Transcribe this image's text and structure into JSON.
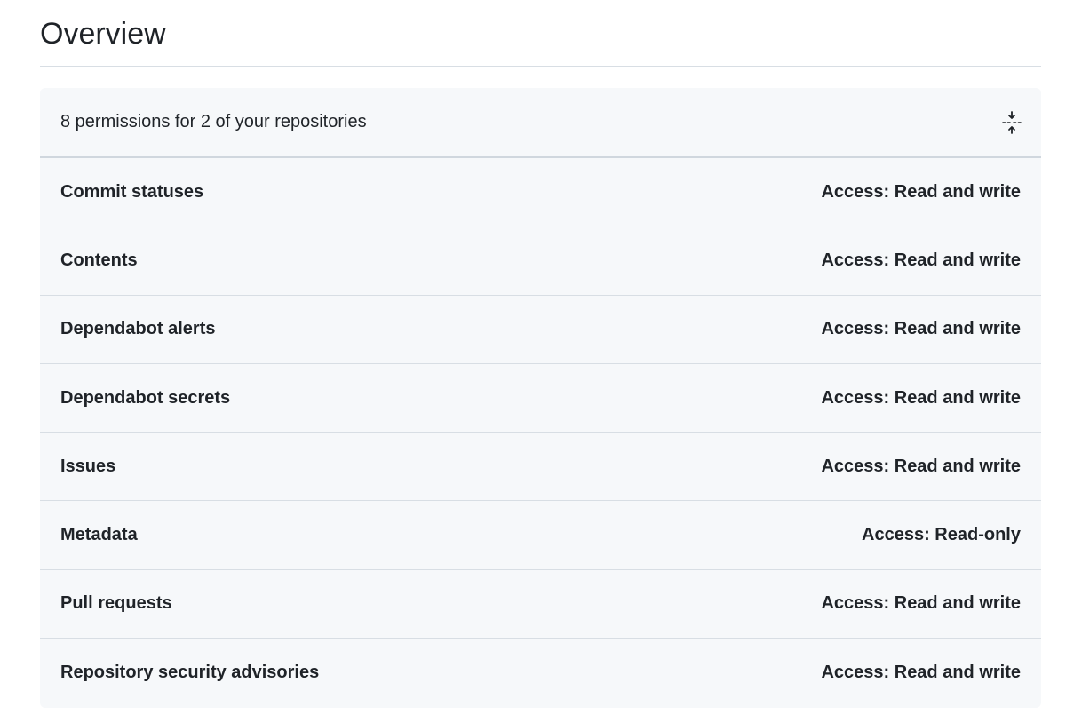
{
  "page": {
    "title": "Overview"
  },
  "panel": {
    "summary": "8 permissions for 2 of your repositories",
    "collapse_icon": "fold-icon"
  },
  "permissions": [
    {
      "name": "Commit statuses",
      "access": "Access: Read and write"
    },
    {
      "name": "Contents",
      "access": "Access: Read and write"
    },
    {
      "name": "Dependabot alerts",
      "access": "Access: Read and write"
    },
    {
      "name": "Dependabot secrets",
      "access": "Access: Read and write"
    },
    {
      "name": "Issues",
      "access": "Access: Read and write"
    },
    {
      "name": "Metadata",
      "access": "Access: Read-only"
    },
    {
      "name": "Pull requests",
      "access": "Access: Read and write"
    },
    {
      "name": "Repository security advisories",
      "access": "Access: Read and write"
    }
  ]
}
